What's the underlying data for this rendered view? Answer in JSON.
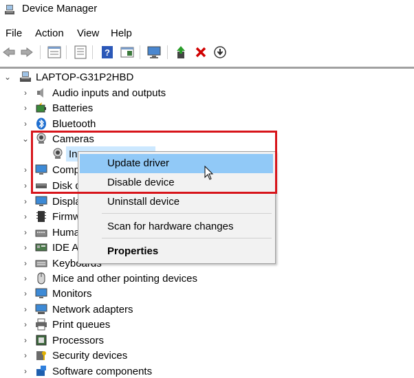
{
  "window": {
    "title": "Device Manager"
  },
  "menu": [
    "File",
    "Action",
    "View",
    "Help"
  ],
  "toolbar": {
    "buttons": [
      "back-icon",
      "forward-icon",
      "properties-icon",
      "details-icon",
      "help-icon",
      "view-icon",
      "monitor-scan-icon",
      "update-driver-icon",
      "uninstall-icon",
      "disable-icon"
    ]
  },
  "tree": {
    "root": "LAPTOP-G31P2HBD",
    "nodes": [
      {
        "label": "Audio inputs and outputs"
      },
      {
        "label": "Batteries"
      },
      {
        "label": "Bluetooth"
      },
      {
        "label": "Cameras"
      },
      {
        "label": "In"
      },
      {
        "label": "Comp"
      },
      {
        "label": "Disk d"
      },
      {
        "label": "Displa"
      },
      {
        "label": "Firmw"
      },
      {
        "label": "Huma"
      },
      {
        "label": "IDE AT"
      },
      {
        "label": "Keyboards"
      },
      {
        "label": "Mice and other pointing devices"
      },
      {
        "label": "Monitors"
      },
      {
        "label": "Network adapters"
      },
      {
        "label": "Print queues"
      },
      {
        "label": "Processors"
      },
      {
        "label": "Security devices"
      },
      {
        "label": "Software components"
      }
    ]
  },
  "context_menu": {
    "items": [
      "Update driver",
      "Disable device",
      "Uninstall device",
      "Scan for hardware changes",
      "Properties"
    ]
  },
  "colors": {
    "highlight_box": "#d7141a",
    "menu_hover": "#91c9f7",
    "selection": "#cce8ff"
  }
}
